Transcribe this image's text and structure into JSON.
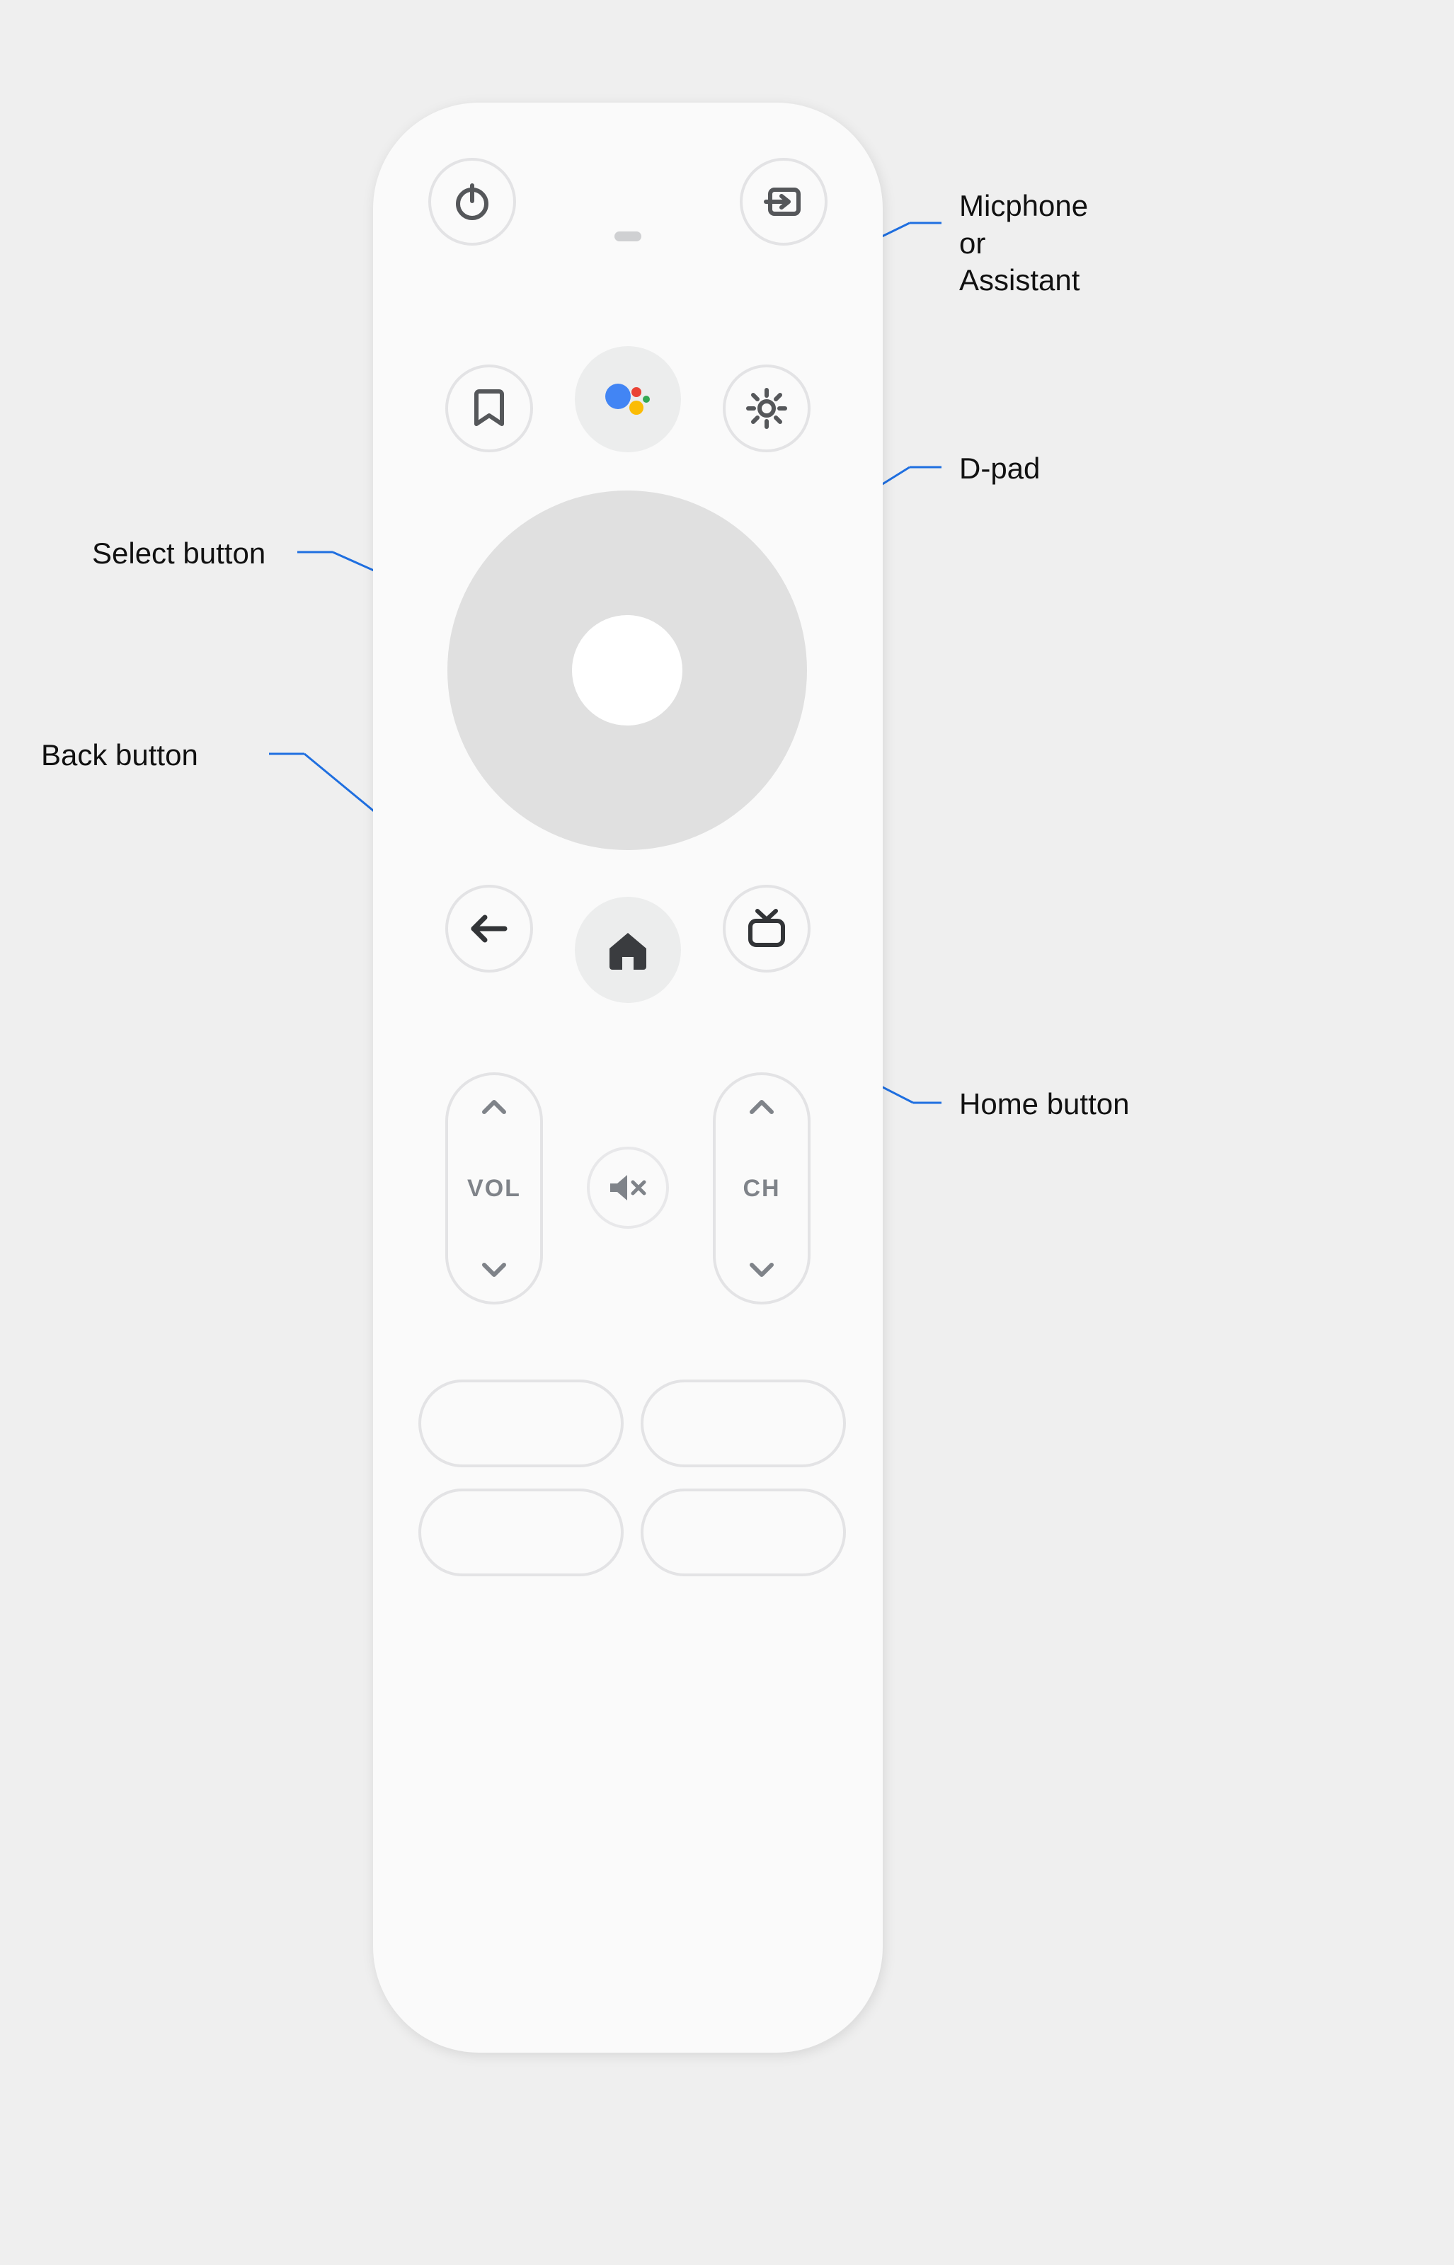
{
  "remote": {
    "rockers": {
      "volume_label": "VOL",
      "channel_label": "CH"
    }
  },
  "callouts": {
    "assistant": "Micphone\nor\nAssistant",
    "dpad": "D-pad",
    "select": "Select button",
    "back": "Back button",
    "home": "Home button"
  }
}
